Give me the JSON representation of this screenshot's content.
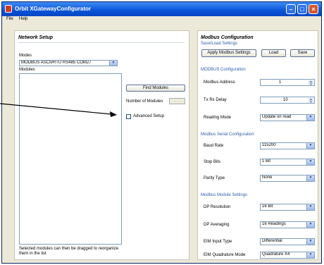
{
  "window": {
    "title": "Orbit XGatewayConfigurator"
  },
  "menu": {
    "file": "File",
    "help": "Help"
  },
  "network": {
    "heading": "Network Setup",
    "modes_label": "Modes",
    "mode_value": "MODBUS ASCII/RTU RS485 COM27",
    "modules_label": "Modules",
    "find_button": "Find Modules",
    "number_label": "Number of Modules",
    "number_value": "",
    "advanced_label": "Advanced Setup",
    "footer_note": "Selected modules can then be dragged to reorganize them in the list"
  },
  "modbus": {
    "heading": "Modbus Configuration",
    "saveload_group": "Save/Load Settings",
    "apply_button": "Apply Modbus Settings",
    "load_button": "Load",
    "save_button": "Save",
    "config_group": "MODBUS Configuration",
    "address_label": "Modbus Address",
    "address_value": "1",
    "txrx_label": "Tx Rx Delay",
    "txrx_value": "10",
    "reading_label": "Reading Mode",
    "reading_value": "Update on read",
    "serial_group": "Modbus Serial Configuration",
    "baud_label": "Baud Rate",
    "baud_value": "115200",
    "stop_label": "Stop Bits",
    "stop_value": "1 Bit",
    "parity_label": "Parity Type",
    "parity_value": "None",
    "module_group": "Modbus Module Settings",
    "dp_res_label": "DP Resolution",
    "dp_res_value": "16 Bit",
    "dp_avg_label": "DP Averaging",
    "dp_avg_value": "16 Readings",
    "eim_input_label": "EIM Input Type",
    "eim_input_value": "Differential",
    "eim_quad_label": "EIM Quadrature Mode",
    "eim_quad_value": "Quadrature X4"
  }
}
